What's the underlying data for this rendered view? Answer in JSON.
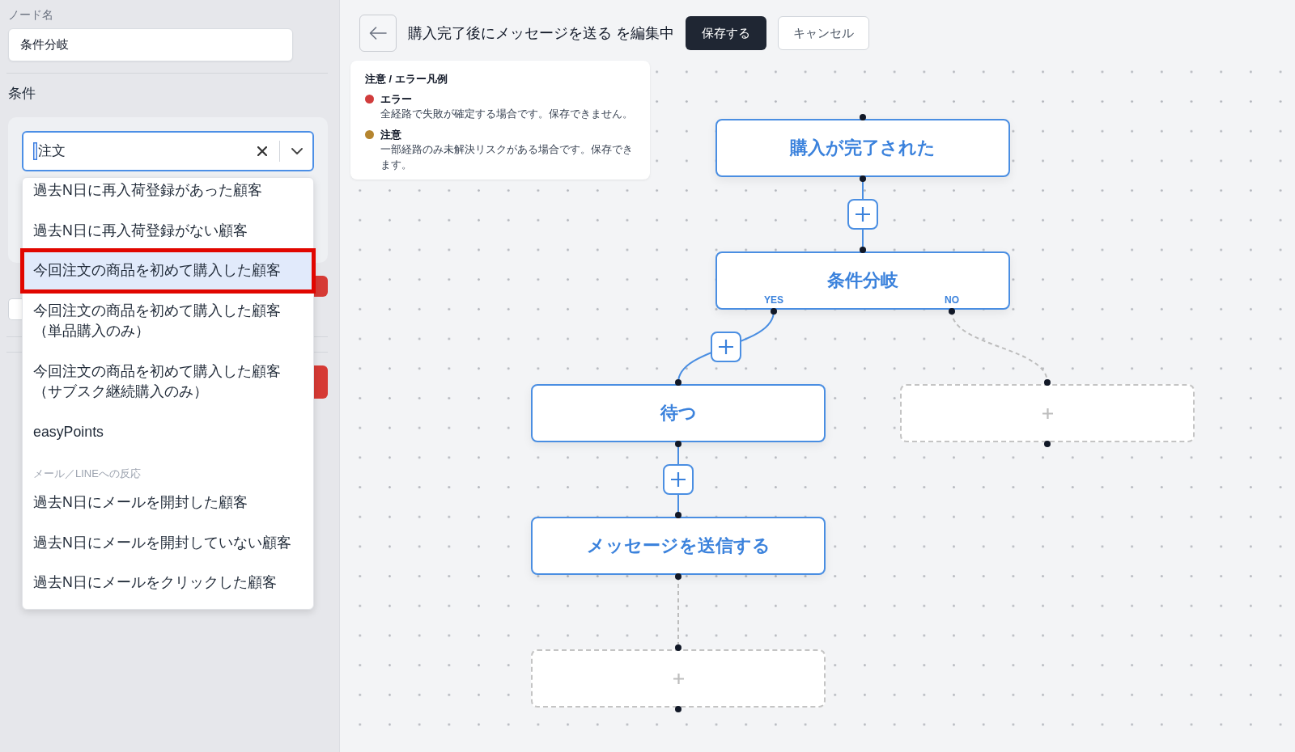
{
  "sidebar": {
    "node_name": {
      "label": "ノード名",
      "value": "条件分岐"
    },
    "conditions": {
      "title": "条件",
      "select": {
        "value": "注文"
      },
      "options": [
        {
          "kind": "option",
          "label": "過去N日に再入荷登録があった顧客",
          "selected": false,
          "outlined": false
        },
        {
          "kind": "option",
          "label": "過去N日に再入荷登録がない顧客",
          "selected": false,
          "outlined": false
        },
        {
          "kind": "option",
          "label": "今回注文の商品を初めて購入した顧客",
          "selected": true,
          "outlined": true
        },
        {
          "kind": "option",
          "label": "今回注文の商品を初めて購入した顧客（単品購入のみ）",
          "selected": false,
          "outlined": false
        },
        {
          "kind": "option",
          "label": "今回注文の商品を初めて購入した顧客（サブスク継続購入のみ）",
          "selected": false,
          "outlined": false
        },
        {
          "kind": "option",
          "label": "easyPoints",
          "selected": false,
          "outlined": false
        },
        {
          "kind": "group",
          "label": "メール／LINEへの反応"
        },
        {
          "kind": "option",
          "label": "過去N日にメールを開封した顧客",
          "selected": false,
          "outlined": false
        },
        {
          "kind": "option",
          "label": "過去N日にメールを開封していない顧客",
          "selected": false,
          "outlined": false
        },
        {
          "kind": "option",
          "label": "過去N日にメールをクリックした顧客",
          "selected": false,
          "outlined": false
        }
      ]
    }
  },
  "header": {
    "title": "購入完了後にメッセージを送る を編集中",
    "buttons": [
      {
        "kind": "primary",
        "label": "保存する"
      },
      {
        "kind": "secondary",
        "label": "キャンセル"
      }
    ]
  },
  "legend": {
    "title": "注意 / エラー凡例",
    "items": [
      {
        "label": "エラー",
        "description": "全経路で失敗が確定する場合です。保存できません。",
        "color": "#d13c3c"
      },
      {
        "label": "注意",
        "description": "一部経路のみ未解決リスクがある場合です。保存できます。",
        "color": "#b5852f"
      }
    ]
  },
  "flow": {
    "nodes": [
      {
        "kind": "step",
        "label": "購入が完了された"
      },
      {
        "kind": "branch",
        "label": "条件分岐",
        "branches": [
          {
            "label": "YES",
            "nodes": [
              {
                "kind": "step",
                "label": "待つ"
              },
              {
                "kind": "step",
                "label": "メッセージを送信する"
              },
              {
                "kind": "empty"
              }
            ]
          },
          {
            "label": "NO",
            "nodes": [
              {
                "kind": "empty"
              }
            ]
          }
        ]
      }
    ]
  }
}
